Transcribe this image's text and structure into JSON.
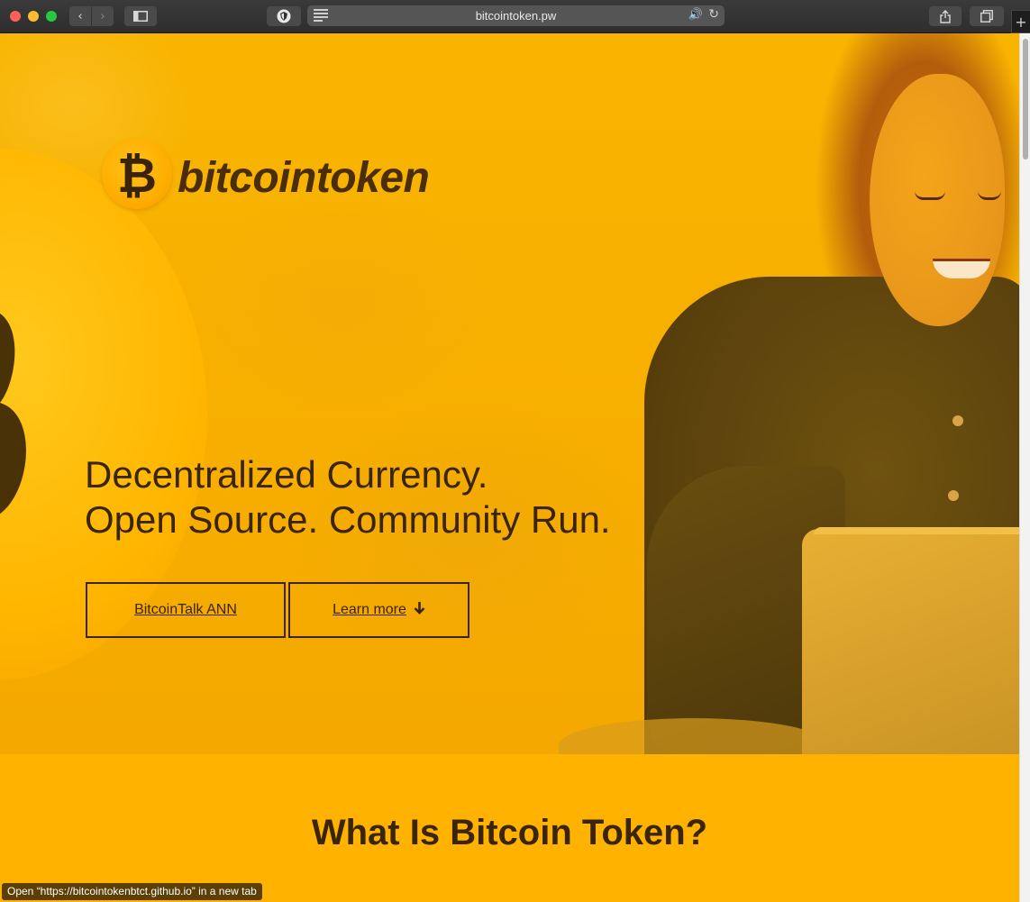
{
  "browser": {
    "url": "bitcointoken.pw",
    "back_glyph": "‹",
    "forward_glyph": "›",
    "audio_glyph": "🔊",
    "reload_glyph": "↻",
    "new_tab_glyph": "+",
    "status_text": "Open “https://bitcointokenbtct.github.io” in a new tab"
  },
  "logo": {
    "glyph": "₿",
    "text": "bitcointoken"
  },
  "hero": {
    "headline_line1": "Decentralized Currency.",
    "headline_line2": "Open Source. Community Run.",
    "buttons": {
      "ann_label": "BitcoinTalk ANN",
      "learn_label": "Learn more",
      "learn_arrow": "🡓"
    }
  },
  "section": {
    "title": "What Is Bitcoin Token?"
  },
  "colors": {
    "accent": "#ffb300",
    "text_dark": "#3a2508",
    "logo_text": "#4a2e07"
  }
}
